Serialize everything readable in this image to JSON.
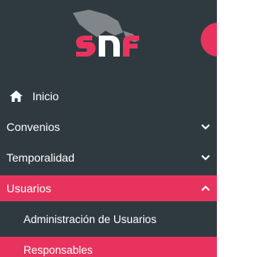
{
  "logo": {
    "text": "SNF"
  },
  "menu": {
    "inicio": "Inicio",
    "convenios": "Convenios",
    "temporalidad": "Temporalidad",
    "usuarios": "Usuarios",
    "sub": {
      "administracion": "Administración de Usuarios",
      "responsables": "Responsables"
    }
  },
  "colors": {
    "sidebar_bg": "#2f3a40",
    "accent": "#e8335f"
  }
}
